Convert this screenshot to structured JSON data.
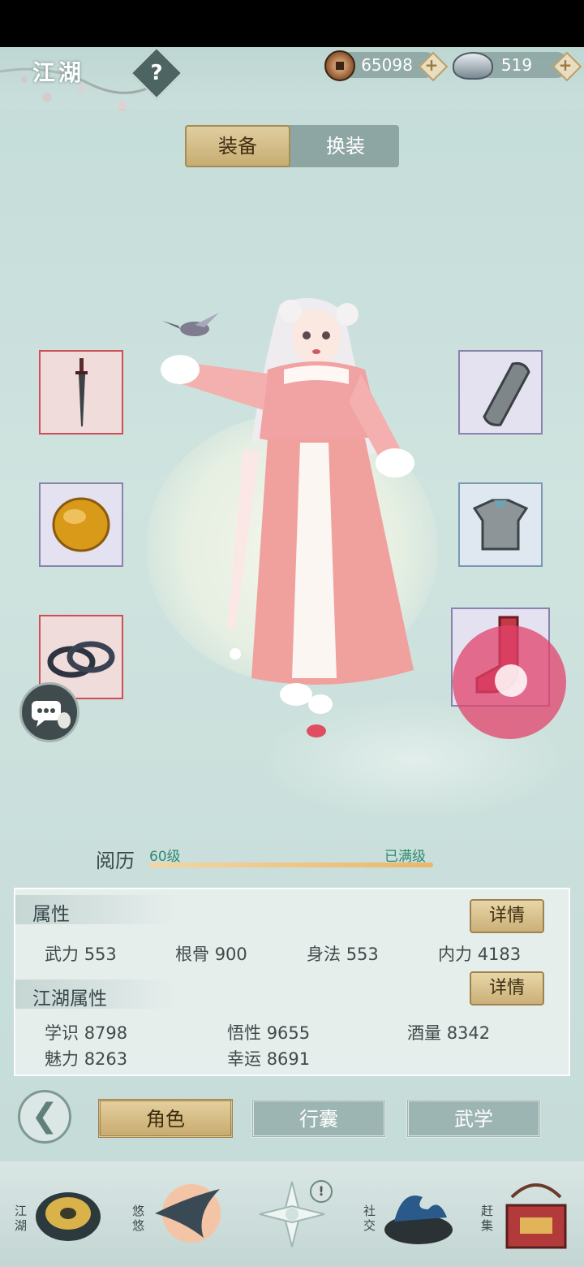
{
  "header": {
    "title": "江湖",
    "help_label": "?",
    "copper_amount": "65098",
    "silver_amount": "519",
    "add_label": "+"
  },
  "top_tabs": [
    {
      "label": "装备",
      "active": true
    },
    {
      "label": "换装",
      "active": false
    }
  ],
  "equipment_slots": [
    {
      "name": "weapon",
      "icon": "dagger-icon",
      "rarity_color": "#cf4e57"
    },
    {
      "name": "accessory",
      "icon": "amber-stone-icon",
      "rarity_color": "#8a83ae"
    },
    {
      "name": "bracelet",
      "icon": "bracelets-icon",
      "rarity_color": "#cf4e57"
    },
    {
      "name": "bracer",
      "icon": "bracer-icon",
      "rarity_color": "#8a83ae"
    },
    {
      "name": "armor",
      "icon": "chest-armor-icon",
      "rarity_color": "#7b98b3"
    },
    {
      "name": "boots",
      "icon": "red-boot-icon",
      "rarity_color": "#8a83ae"
    }
  ],
  "experience": {
    "label": "阅历",
    "level": "60级",
    "status": "已满级",
    "progress": 1.0
  },
  "attributes": {
    "title": "属性",
    "detail_label": "详情",
    "stats": [
      {
        "name": "武力",
        "value": "553"
      },
      {
        "name": "根骨",
        "value": "900"
      },
      {
        "name": "身法",
        "value": "553"
      },
      {
        "name": "内力",
        "value": "4183"
      }
    ]
  },
  "jianghu_attributes": {
    "title": "江湖属性",
    "detail_label": "详情",
    "stats": [
      {
        "name": "学识",
        "value": "8798"
      },
      {
        "name": "悟性",
        "value": "9655"
      },
      {
        "name": "酒量",
        "value": "8342"
      },
      {
        "name": "魅力",
        "value": "8263"
      },
      {
        "name": "幸运",
        "value": "8691"
      }
    ]
  },
  "bottom_nav": [
    {
      "label": "角色",
      "active": true
    },
    {
      "label": "行囊",
      "active": false
    },
    {
      "label": "武学",
      "active": false
    }
  ],
  "tab_bar": [
    {
      "label": "江湖"
    },
    {
      "label": "悠悠"
    },
    {
      "label": ""
    },
    {
      "label": "社交"
    },
    {
      "label": "赶集"
    }
  ],
  "colors": {
    "accent_gold": "#c8ab6f",
    "rarity_red": "#cf4e57",
    "exp_green": "#2f8a6e",
    "touch_indicator": "#e2426b"
  }
}
